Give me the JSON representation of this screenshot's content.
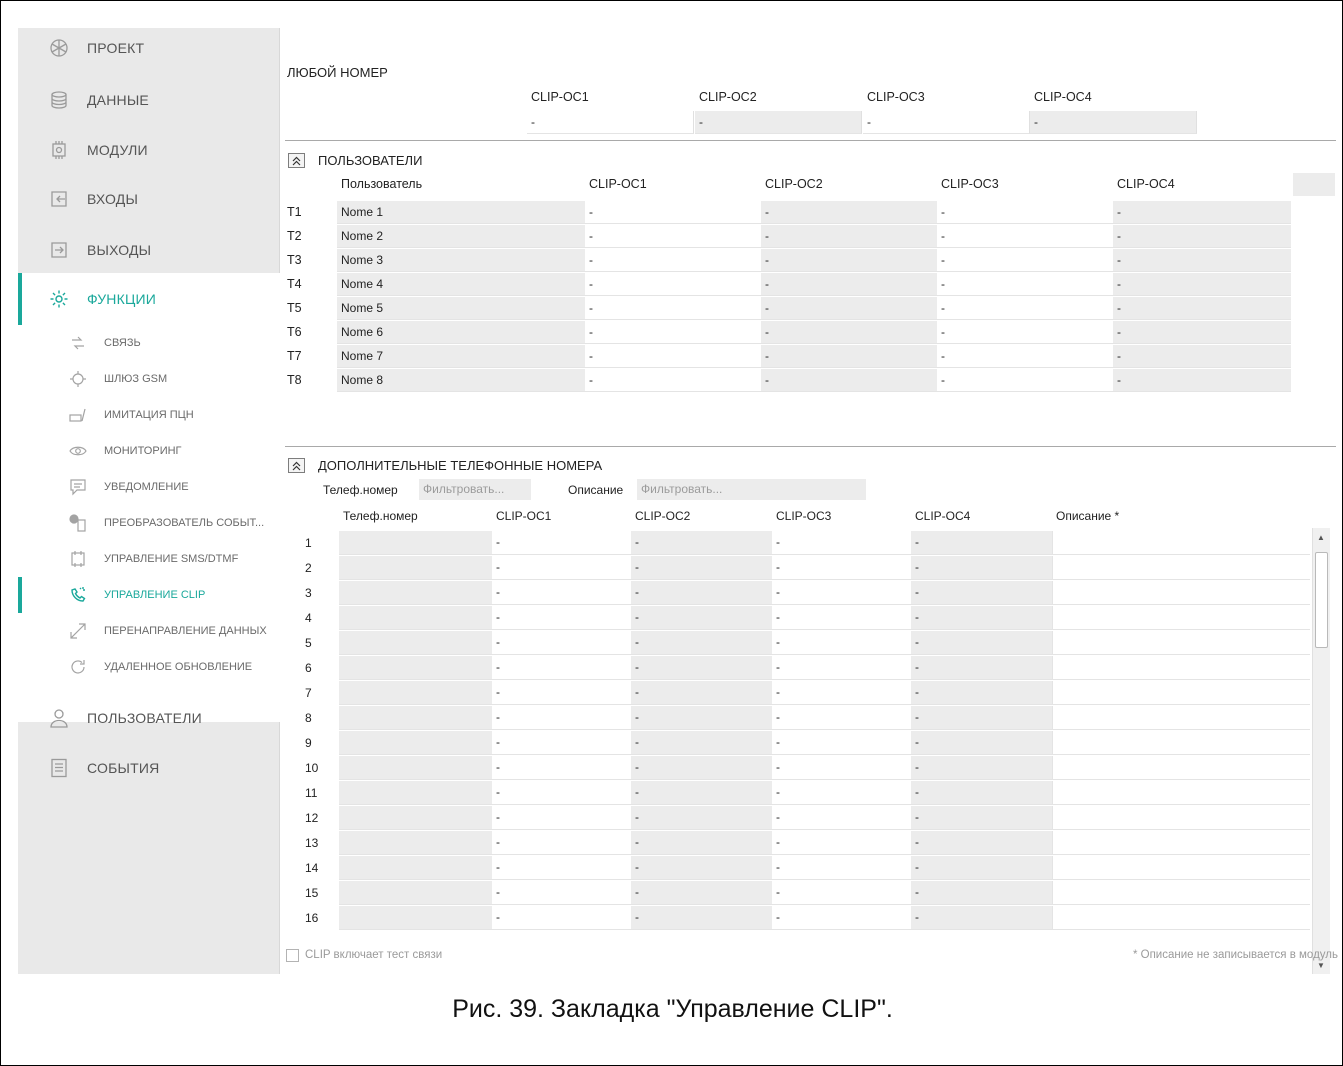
{
  "sidebar": {
    "main_items": [
      {
        "label": "ПРОЕКТ",
        "icon": "snowflake-icon"
      },
      {
        "label": "ДАННЫЕ",
        "icon": "database-icon"
      },
      {
        "label": "МОДУЛИ",
        "icon": "chip-icon"
      },
      {
        "label": "ВХОДЫ",
        "icon": "input-arrow-icon"
      },
      {
        "label": "ВЫХОДЫ",
        "icon": "output-arrow-icon"
      },
      {
        "label": "ФУНКЦИИ",
        "icon": "gear-icon",
        "active": true
      }
    ],
    "sub_items": [
      {
        "label": "СВЯЗЬ",
        "icon": "link-arrows-icon"
      },
      {
        "label": "ШЛЮЗ GSM",
        "icon": "gsm-gateway-icon"
      },
      {
        "label": "ИМИТАЦИЯ ПЦН",
        "icon": "station-icon"
      },
      {
        "label": "МОНИТОРИНГ",
        "icon": "eye-icon"
      },
      {
        "label": "УВЕДОМЛЕНИЕ",
        "icon": "message-icon"
      },
      {
        "label": "ПРЕОБРАЗОВАТЕЛЬ СОБЫТ...",
        "icon": "converter-icon"
      },
      {
        "label": "УПРАВЛЕНИЕ SMS/DTMF",
        "icon": "sms-control-icon"
      },
      {
        "label": "УПРАВЛЕНИЕ CLIP",
        "icon": "phone-clip-icon",
        "active": true
      },
      {
        "label": "ПЕРЕНАПРАВЛЕНИЕ ДАННЫХ",
        "icon": "redirect-icon"
      },
      {
        "label": "УДАЛЕННОЕ ОБНОВЛЕНИЕ",
        "icon": "refresh-icon"
      }
    ],
    "bottom_items": [
      {
        "label": "ПОЛЬЗОВАТЕЛИ",
        "icon": "user-icon"
      },
      {
        "label": "СОБЫТИЯ",
        "icon": "document-icon"
      }
    ]
  },
  "any_number": {
    "title": "ЛЮБОЙ НОМЕР",
    "columns": [
      "CLIP-OC1",
      "CLIP-OC2",
      "CLIP-OC3",
      "CLIP-OC4"
    ],
    "values": [
      "-",
      "-",
      "-",
      "-"
    ]
  },
  "users": {
    "title": "ПОЛЬЗОВАТЕЛИ",
    "collapse_glyph": "⌃",
    "headers": [
      "Пользователь",
      "CLIP-OC1",
      "CLIP-OC2",
      "CLIP-OC3",
      "CLIP-OC4"
    ],
    "rows": [
      {
        "id": "T1",
        "name": "Nome 1",
        "v": [
          "-",
          "-",
          "-",
          "-"
        ]
      },
      {
        "id": "T2",
        "name": "Nome 2",
        "v": [
          "-",
          "-",
          "-",
          "-"
        ]
      },
      {
        "id": "T3",
        "name": "Nome 3",
        "v": [
          "-",
          "-",
          "-",
          "-"
        ]
      },
      {
        "id": "T4",
        "name": "Nome 4",
        "v": [
          "-",
          "-",
          "-",
          "-"
        ]
      },
      {
        "id": "T5",
        "name": "Nome 5",
        "v": [
          "-",
          "-",
          "-",
          "-"
        ]
      },
      {
        "id": "T6",
        "name": "Nome 6",
        "v": [
          "-",
          "-",
          "-",
          "-"
        ]
      },
      {
        "id": "T7",
        "name": "Nome 7",
        "v": [
          "-",
          "-",
          "-",
          "-"
        ]
      },
      {
        "id": "T8",
        "name": "Nome 8",
        "v": [
          "-",
          "-",
          "-",
          "-"
        ]
      }
    ]
  },
  "extra_numbers": {
    "title": "ДОПОЛНИТЕЛЬНЫЕ ТЕЛЕФОННЫЕ НОМЕРА",
    "filter_phone_label": "Телеф.номер",
    "filter_phone_placeholder": "Фильтровать...",
    "filter_desc_label": "Описание",
    "filter_desc_placeholder": "Фильтровать...",
    "headers": [
      "Телеф.номер",
      "CLIP-OC1",
      "CLIP-OC2",
      "CLIP-OC3",
      "CLIP-OC4",
      "Описание *"
    ],
    "rows": [
      {
        "n": "1",
        "v": [
          "-",
          "-",
          "-",
          "-"
        ]
      },
      {
        "n": "2",
        "v": [
          "-",
          "-",
          "-",
          "-"
        ]
      },
      {
        "n": "3",
        "v": [
          "-",
          "-",
          "-",
          "-"
        ]
      },
      {
        "n": "4",
        "v": [
          "-",
          "-",
          "-",
          "-"
        ]
      },
      {
        "n": "5",
        "v": [
          "-",
          "-",
          "-",
          "-"
        ]
      },
      {
        "n": "6",
        "v": [
          "-",
          "-",
          "-",
          "-"
        ]
      },
      {
        "n": "7",
        "v": [
          "-",
          "-",
          "-",
          "-"
        ]
      },
      {
        "n": "8",
        "v": [
          "-",
          "-",
          "-",
          "-"
        ]
      },
      {
        "n": "9",
        "v": [
          "-",
          "-",
          "-",
          "-"
        ]
      },
      {
        "n": "10",
        "v": [
          "-",
          "-",
          "-",
          "-"
        ]
      },
      {
        "n": "11",
        "v": [
          "-",
          "-",
          "-",
          "-"
        ]
      },
      {
        "n": "12",
        "v": [
          "-",
          "-",
          "-",
          "-"
        ]
      },
      {
        "n": "13",
        "v": [
          "-",
          "-",
          "-",
          "-"
        ]
      },
      {
        "n": "14",
        "v": [
          "-",
          "-",
          "-",
          "-"
        ]
      },
      {
        "n": "15",
        "v": [
          "-",
          "-",
          "-",
          "-"
        ]
      },
      {
        "n": "16",
        "v": [
          "-",
          "-",
          "-",
          "-"
        ]
      }
    ]
  },
  "footer": {
    "checkbox_label": "CLIP включает тест связи",
    "note": "* Описание не записывается в модуль"
  },
  "caption": "Рис. 39. Закладка \"Управление CLIP\".",
  "colors": {
    "accent": "#1aa89b",
    "sidebar_bg": "#e9e9e9",
    "cell_gray": "#ececec"
  }
}
